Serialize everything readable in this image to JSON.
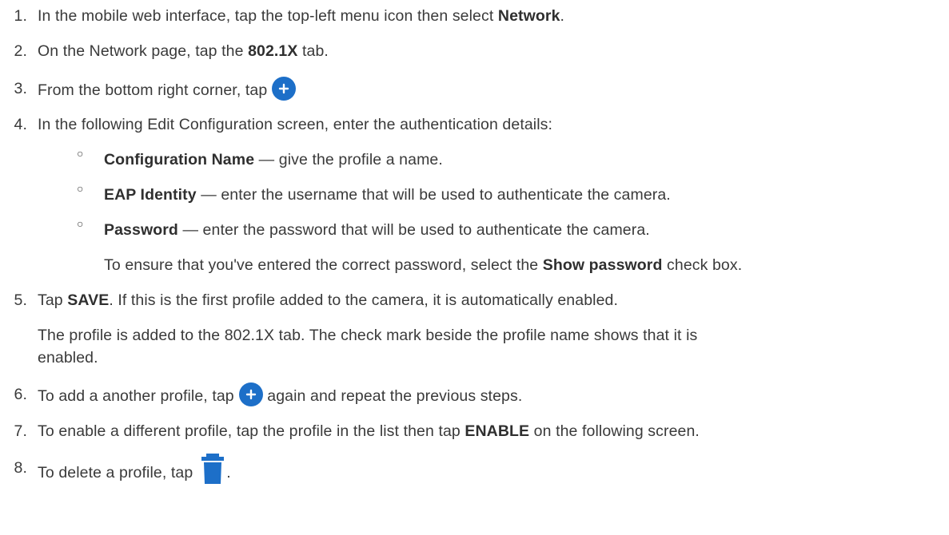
{
  "steps": [
    {
      "num": "1.",
      "pre": "In the mobile web interface, tap the top-left menu icon then select ",
      "bold": "Network",
      "post": "."
    },
    {
      "num": "2.",
      "pre": "On the Network page, tap the ",
      "bold": "802.1X",
      "post": " tab."
    },
    {
      "num": "3.",
      "pre": "From the bottom right corner, tap",
      "icon": "add-circle-icon"
    },
    {
      "num": "4.",
      "text": "In the following Edit Configuration screen, enter the authentication details:",
      "sub_items": [
        {
          "bullet": "○",
          "bold": "Configuration Name",
          "text": " — give the profile a name."
        },
        {
          "bullet": "○",
          "bold": "EAP Identity",
          "text": " — enter the username that will be used to authenticate the camera."
        },
        {
          "bullet": "○",
          "bold": "Password",
          "text": " — enter the password that will be used to authenticate the camera."
        }
      ],
      "note_pre": "To ensure that you've entered the correct password, select the ",
      "note_bold": "Show password",
      "note_post": " check box."
    },
    {
      "num": "5.",
      "pre": "Tap ",
      "bold": "SAVE",
      "post": ". If this is the first profile added to the camera, it is automatically enabled.",
      "para_line1": "The profile is added to the 802.1X tab. The check mark beside the profile name shows that it is",
      "para_line2": "enabled."
    },
    {
      "num": "6.",
      "pre": "To add a another profile, tap",
      "icon": "add-circle-icon",
      "post": " again and repeat the previous steps."
    },
    {
      "num": "7.",
      "pre": "To enable a different profile, tap the profile in the list then tap ",
      "bold": "ENABLE",
      "post": " on the following screen."
    },
    {
      "num": "8.",
      "pre": "To delete a profile, tap",
      "icon": "trash-icon",
      "post": "."
    }
  ],
  "colors": {
    "text": "#3a3a3a",
    "icon_blue": "#1d6fc8"
  }
}
